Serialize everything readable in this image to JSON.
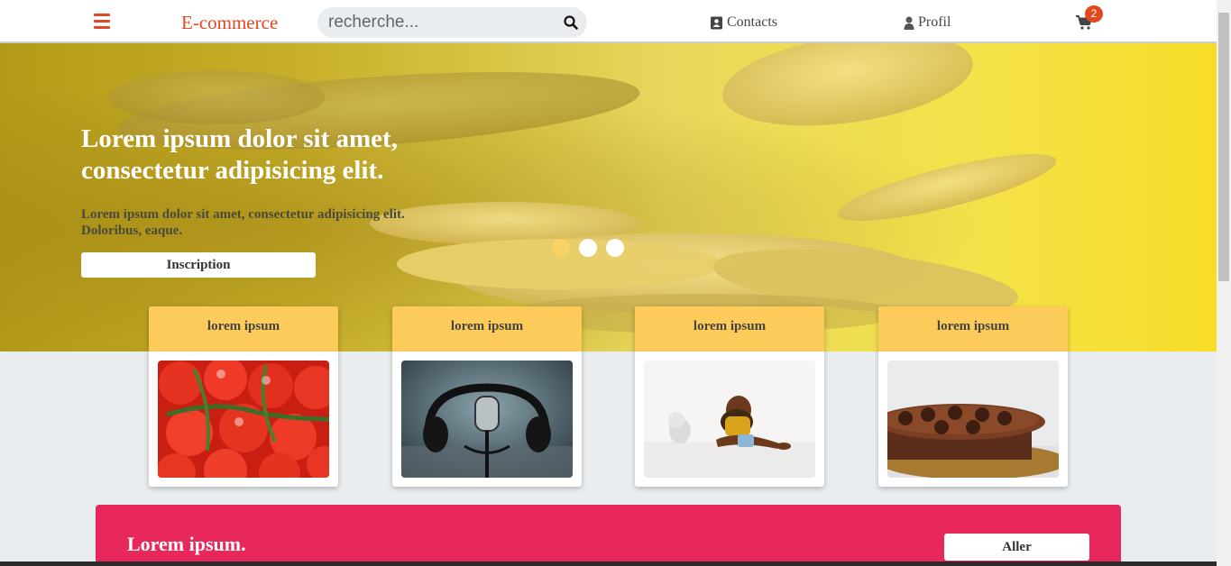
{
  "navbar": {
    "brand": "E-commerce",
    "search_placeholder": "recherche...",
    "contacts": "Contacts",
    "profil": "Profil",
    "cart_count": "2",
    "accent_color": "#e2471e"
  },
  "hero": {
    "title": "Lorem ipsum dolor sit amet, consectetur adipisicing elit.",
    "subtitle": "Lorem ipsum dolor sit amet, consectetur adipisicing elit. Doloribus, eaque.",
    "button": "Inscription",
    "slides_count": 3,
    "active_slide": 1
  },
  "cards": [
    {
      "title": "lorem ipsum",
      "image": "tomatoes"
    },
    {
      "title": "lorem ipsum",
      "image": "microphone-headphones"
    },
    {
      "title": "lorem ipsum",
      "image": "child-playing"
    },
    {
      "title": "lorem ipsum",
      "image": "chocolate-cake"
    }
  ],
  "banner": {
    "title": "Lorem ipsum.",
    "button": "Aller",
    "color": "#e8285a"
  },
  "icons": {
    "menu": "hamburger-icon",
    "search": "search-icon",
    "contacts": "address-book-icon",
    "profil": "user-icon",
    "cart": "cart-icon"
  }
}
